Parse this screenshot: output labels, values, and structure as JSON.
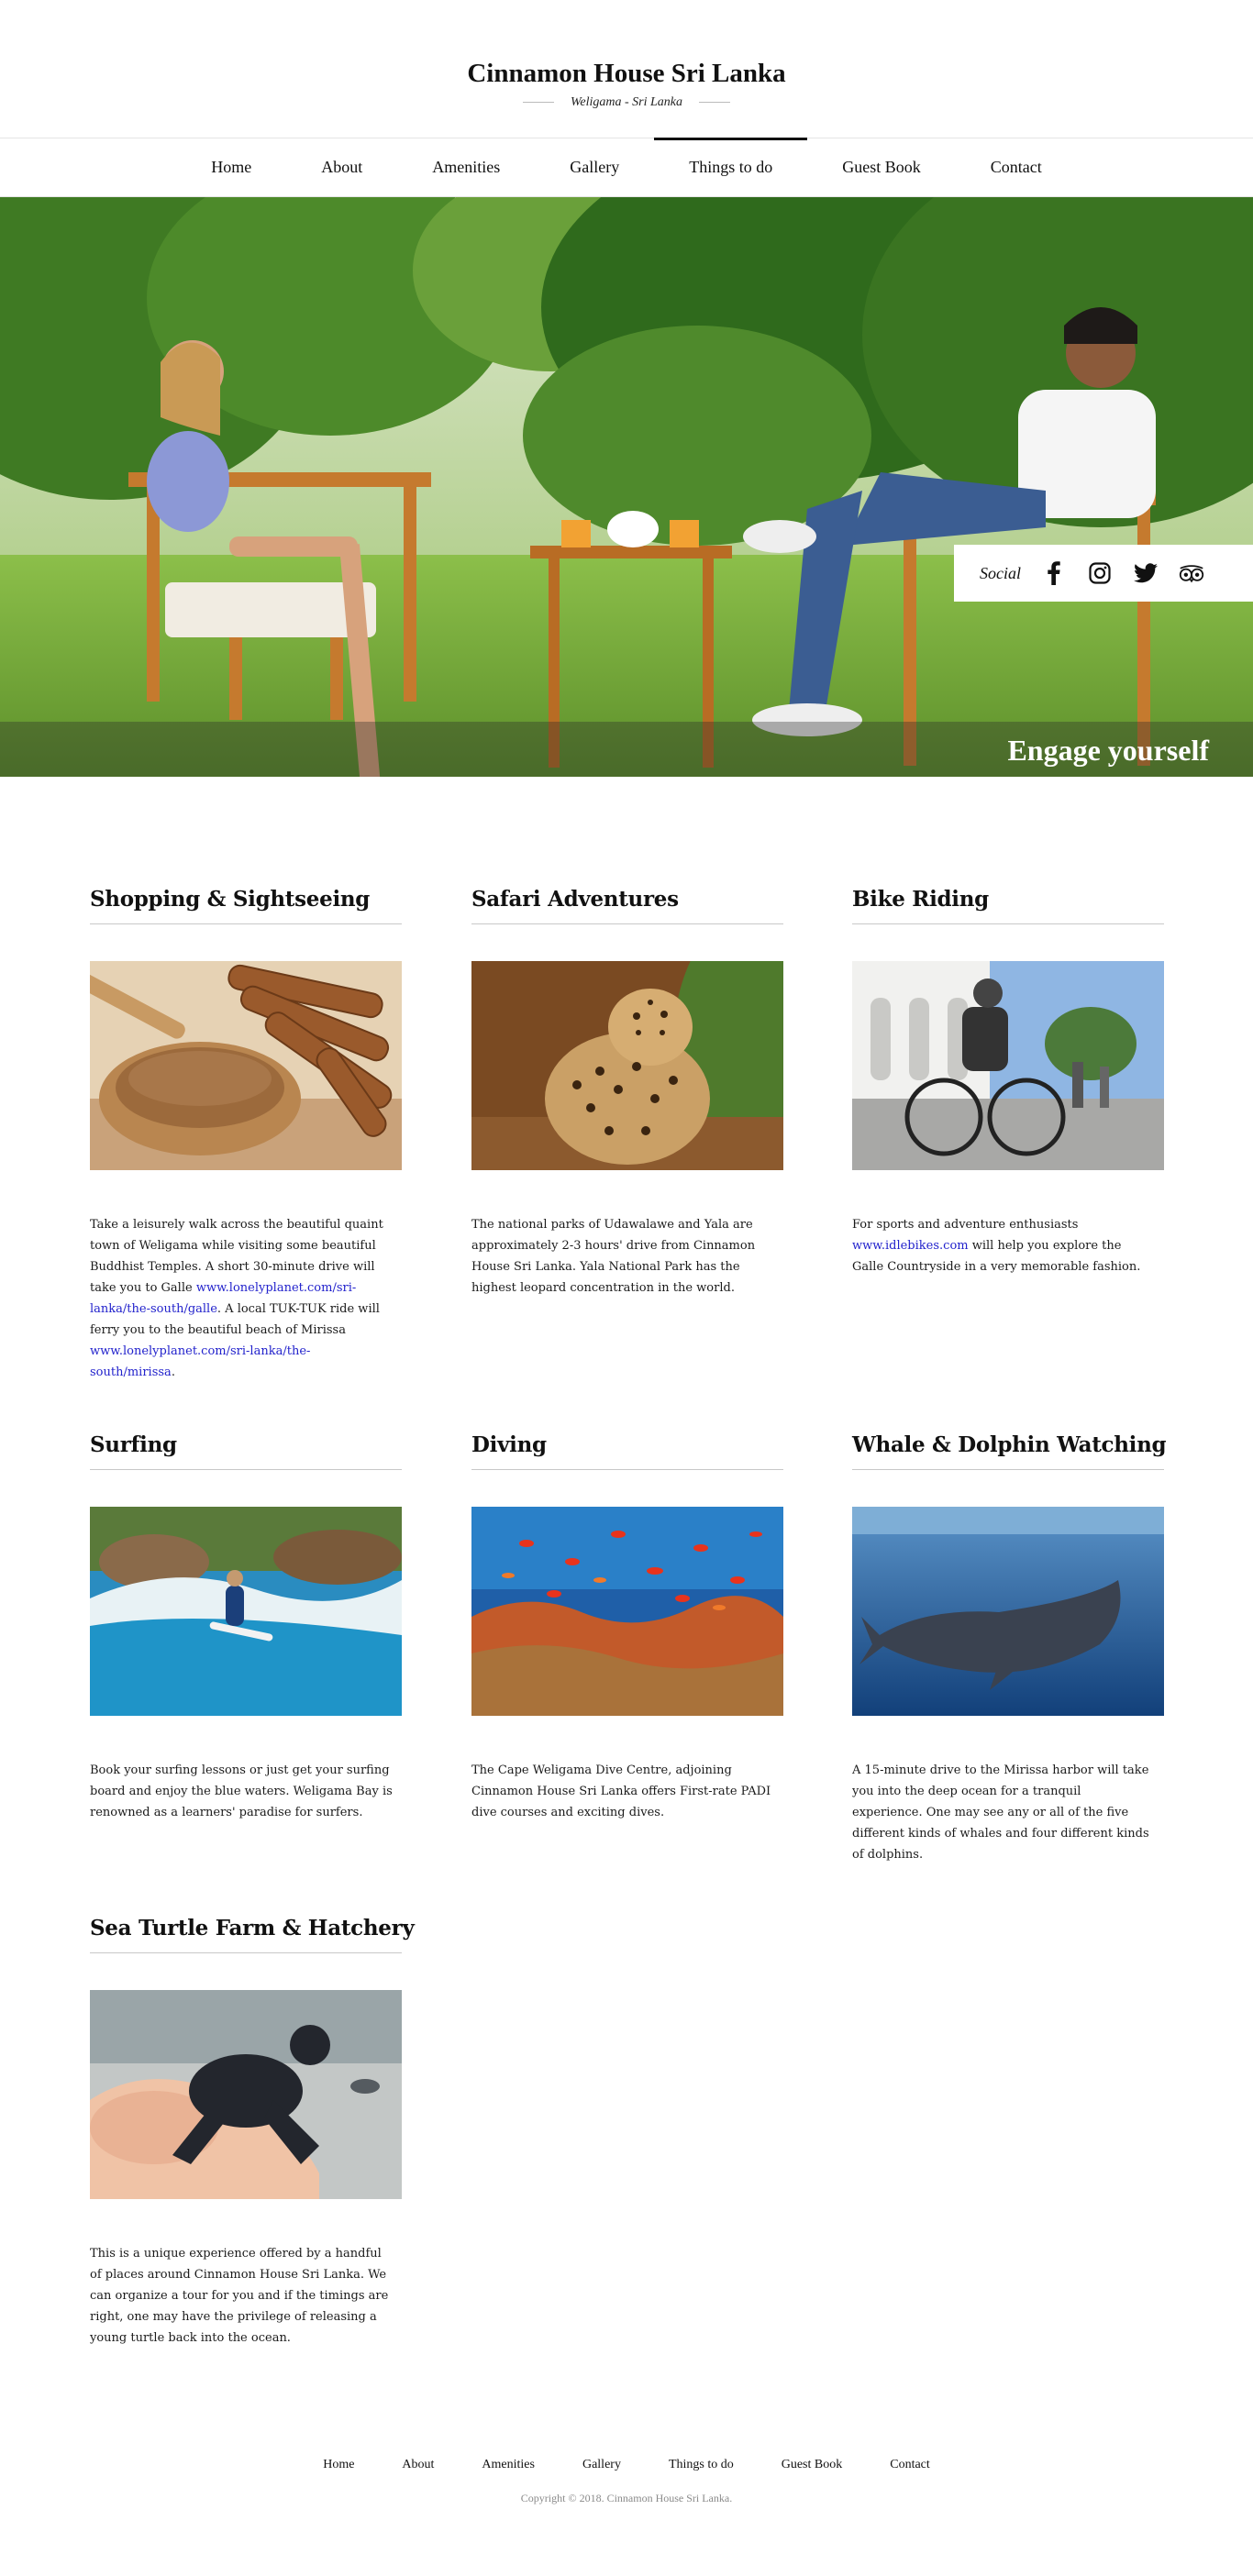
{
  "header": {
    "title": "Cinnamon House Sri Lanka",
    "subtitle": "Weligama - Sri Lanka"
  },
  "nav": {
    "items": [
      "Home",
      "About",
      "Amenities",
      "Gallery",
      "Things to do",
      "Guest Book",
      "Contact"
    ],
    "active": "Things to do"
  },
  "hero": {
    "caption": "Engage yourself",
    "social_label": "Social",
    "social_icons": [
      "facebook-icon",
      "instagram-icon",
      "twitter-icon",
      "tripadvisor-icon"
    ]
  },
  "activities": [
    {
      "title": "Shopping & Sightseeing",
      "image": "cinnamon-spice-photo",
      "text_parts": [
        {
          "t": "Take a leisurely walk across the beautiful quaint town of Weligama while visiting some beautiful Buddhist Temples. A short 30-minute drive will take you to Galle "
        },
        {
          "t": "www.lonelyplanet.com/sri-lanka/the-south/galle",
          "link": true
        },
        {
          "t": ". A local TUK-TUK ride will ferry you to the beautiful beach of Mirissa "
        },
        {
          "t": "www.lonelyplanet.com/sri-lanka/the-south/mirissa",
          "link": true
        },
        {
          "t": "."
        }
      ]
    },
    {
      "title": "Safari Adventures",
      "image": "leopard-photo",
      "text_parts": [
        {
          "t": "The national parks of Udawalawe and Yala are approximately 2-3 hours' drive from Cinnamon House Sri Lanka. Yala National Park has the highest leopard concentration in the world."
        }
      ]
    },
    {
      "title": "Bike Riding",
      "image": "bike-riders-photo",
      "text_parts": [
        {
          "t": "For sports and adventure enthusiasts "
        },
        {
          "t": "www.idlebikes.com",
          "link": true
        },
        {
          "t": " will help you explore the Galle Countryside in a very memorable fashion."
        }
      ]
    },
    {
      "title": "Surfing",
      "image": "surfer-photo",
      "text_parts": [
        {
          "t": "Book your surfing lessons or just get your surfing board and enjoy the blue waters. Weligama Bay is renowned as a learners' paradise for surfers."
        }
      ]
    },
    {
      "title": "Diving",
      "image": "coral-reef-photo",
      "text_parts": [
        {
          "t": "The Cape Weligama Dive Centre, adjoining Cinnamon House Sri Lanka offers First-rate PADI dive courses and exciting dives."
        }
      ]
    },
    {
      "title": "Whale & Dolphin Watching",
      "image": "whale-photo",
      "text_parts": [
        {
          "t": "A 15-minute drive to the Mirissa harbor will take you into the deep ocean for a tranquil experience. One may see any or all of the five different kinds of whales and four different kinds of dolphins."
        }
      ]
    },
    {
      "title": "Sea Turtle Farm & Hatchery",
      "image": "baby-turtle-photo",
      "text_parts": [
        {
          "t": "This is a unique experience offered by a handful of places around Cinnamon House Sri Lanka. We can organize a tour for you and if the timings are right, one may have the privilege of releasing a young turtle back into the ocean."
        }
      ]
    }
  ],
  "footer": {
    "links": [
      "Home",
      "About",
      "Amenities",
      "Gallery",
      "Things to do",
      "Guest Book",
      "Contact"
    ],
    "copyright": "Copyright © 2018. Cinnamon House Sri Lanka."
  }
}
